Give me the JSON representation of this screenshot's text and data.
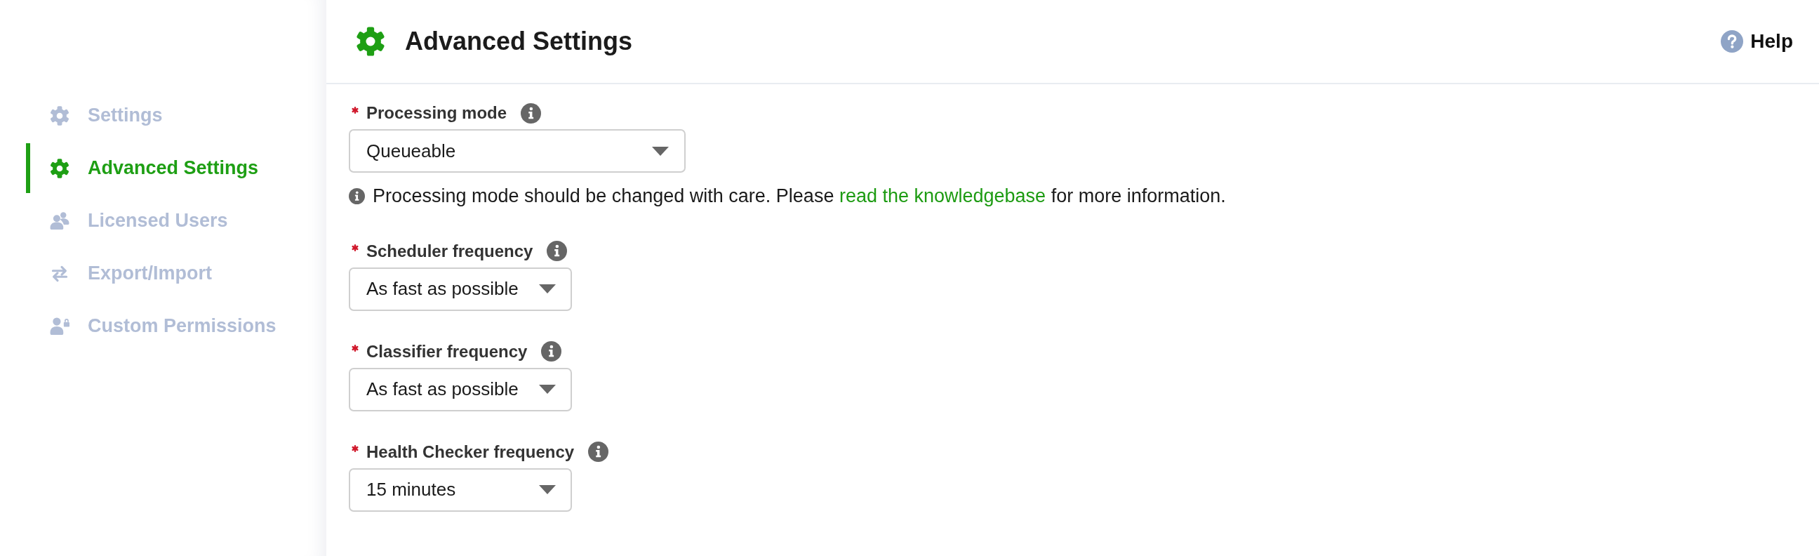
{
  "sidebar": {
    "items": [
      {
        "label": "Settings",
        "selected": false
      },
      {
        "label": "Advanced Settings",
        "selected": true
      },
      {
        "label": "Licensed Users",
        "selected": false
      },
      {
        "label": "Export/Import",
        "selected": false
      },
      {
        "label": "Custom Permissions",
        "selected": false
      }
    ]
  },
  "header": {
    "title": "Advanced Settings",
    "help_link": "Help"
  },
  "form": {
    "fields": [
      {
        "label": "Processing mode",
        "required": true,
        "value": "Queueable",
        "note": {
          "text_before": "Processing mode should be changed with care. Please",
          "link": "read the knowledgebase",
          "text_after": "for more information."
        }
      },
      {
        "label": "Scheduler frequency",
        "required": true,
        "value": "As fast as possible"
      },
      {
        "label": "Classifier frequency",
        "required": true,
        "value": "As fast as possible"
      },
      {
        "label": "Health Checker frequency",
        "required": true,
        "value": "15 minutes"
      }
    ]
  }
}
